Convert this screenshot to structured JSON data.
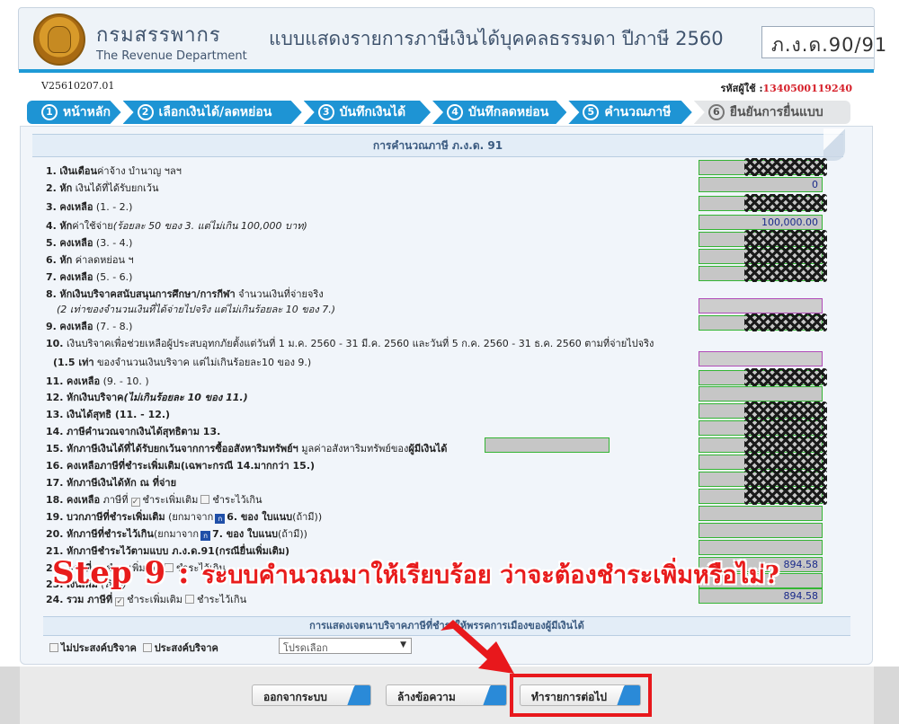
{
  "header": {
    "dept_thai": "กรมสรรพากร",
    "dept_en": "The Revenue Department",
    "title": "แบบแสดงรายการภาษีเงินได้บุคคลธรรมดา ปีภาษี 2560",
    "form_code": "ภ.ง.ด.90/91"
  },
  "version": "V25610207.01",
  "user": {
    "label": "รหัสผู้ใช้ :",
    "id": "1340500119240"
  },
  "steps": [
    {
      "num": "1",
      "label": "หน้าหลัก"
    },
    {
      "num": "2",
      "label": "เลือกเงินได้/ลดหย่อน"
    },
    {
      "num": "3",
      "label": "บันทึกเงินได้"
    },
    {
      "num": "4",
      "label": "บันทึกลดหย่อน"
    },
    {
      "num": "5",
      "label": "คำนวณภาษี"
    },
    {
      "num": "6",
      "label": "ยืนยันการยื่นแบบ"
    }
  ],
  "section_title": "การคำนวณภาษี ภ.ง.ด. 91",
  "rows": {
    "r1": {
      "no": "1.",
      "bold": "เงินเดือน",
      "rest": "ค่าจ้าง บำนาญ ฯลฯ"
    },
    "r2": {
      "no": "2.",
      "bold": "หัก",
      "rest": " เงินได้ที่ได้รับยกเว้น",
      "value": "0"
    },
    "r3": {
      "no": "3.",
      "bold": "คงเหลือ",
      "rest": " (1. - 2.)"
    },
    "r4": {
      "no": "4.",
      "bold": "หัก",
      "rest": "ค่าใช้จ่าย",
      "italic": "(ร้อยละ 50 ของ 3. แต่ไม่เกิน 100,000 บาท)",
      "value": "100,000.00"
    },
    "r5": {
      "no": "5.",
      "bold": "คงเหลือ",
      "rest": " (3. - 4.)"
    },
    "r6": {
      "no": "6.",
      "bold": "หัก",
      "rest": " ค่าลดหย่อน ฯ"
    },
    "r7": {
      "no": "7.",
      "bold": "คงเหลือ",
      "rest": " (5. - 6.)"
    },
    "r8": {
      "no": "8.",
      "bold": "หักเงินบริจาคสนับสนุนการศึกษา/การกีฬา",
      "rest": " จำนวนเงินที่จ่ายจริง",
      "sub": "(2 เท่าของจำนวนเงินที่ได้จ่ายไปจริง แต่ไม่เกินร้อยละ 10 ของ 7.)"
    },
    "r9": {
      "no": "9.",
      "bold": "คงเหลือ",
      "rest": " (7. - 8.)"
    },
    "r10": {
      "no": "10.",
      "text": "เงินบริจาคเพื่อช่วยเหลือผู้ประสบอุทกภัยตั้งแต่วันที่ 1 ม.ค. 2560 - 31 มี.ค. 2560 และวันที่ 5 ก.ค. 2560 - 31 ธ.ค. 2560 ตามที่จ่ายไปจริง",
      "sub_bold": "(1.5 เท่า",
      "sub_rest": " ของจำนวนเงินบริจาค แต่ไม่เกินร้อยละ10 ของ 9.)"
    },
    "r11": {
      "no": "11.",
      "bold": "คงเหลือ",
      "rest": " (9. - 10. )"
    },
    "r12": {
      "no": "12.",
      "bold": "หักเงินบริจาค",
      "italic": "(ไม่เกินร้อยละ 10 ของ 11.)"
    },
    "r13": {
      "no": "13.",
      "bold": "เงินได้สุทธิ (11. - 12.)"
    },
    "r14": {
      "no": "14.",
      "bold": "ภาษีคำนวณจากเงินได้สุทธิตาม 13."
    },
    "r15": {
      "no": "15.",
      "bold": "หักภาษีเงินได้ที่ได้รับยกเว้นจากการซื้ออสังหาริมทรัพย์ฯ",
      "rest": " มูลค่าอสังหาริมทรัพย์ของ",
      "bold2": "ผู้มีเงินได้"
    },
    "r16": {
      "no": "16.",
      "bold": "คงเหลือภาษีที่ชำระเพิ่มเติม(เฉพาะกรณี 14.มากกว่า 15.)"
    },
    "r17": {
      "no": "17.",
      "bold": "หักภาษีเงินได้หัก ณ ที่จ่าย"
    },
    "r18": {
      "no": "18.",
      "bold": "คงเหลือ",
      "rest": " ภาษีที่",
      "opt1": "ชำระเพิ่มเติม",
      "opt2": "ชำระไว้เกิน"
    },
    "r19": {
      "no": "19.",
      "bold": "บวกภาษีที่ชำระเพิ่มเติม",
      "rest": " (ยกมาจาก",
      "ref": "6. ของ ใบแนบ",
      "tail": "(ถ้ามี))"
    },
    "r20": {
      "no": "20.",
      "bold": "หักภาษีที่ชำระไว้เกิน",
      "rest": "(ยกมาจาก",
      "ref": "7. ของ ใบแนบ",
      "tail": "(ถ้ามี))"
    },
    "r21": {
      "no": "21.",
      "bold": "หักภาษีชำระไว้ตามแบบ ภ.ง.ด.91(กรณียื่นเพิ่มเติม)"
    },
    "r22": {
      "no": "22.",
      "bold": "ภาษีที่",
      "opt1": "ชำระเพิ่มเติม",
      "opt2": "ชำระไว้เกิน",
      "value": "894.58"
    },
    "r23": {
      "no": "23.",
      "bold": "เงินเพิ่ม",
      "rest": " (ถ้ามี)"
    },
    "r24": {
      "no": "24.",
      "bold": "รวม ภาษีที่",
      "opt1": "ชำระเพิ่มเติม",
      "opt2": "ชำระไว้เกิน",
      "value": "894.58"
    }
  },
  "annotation": {
    "step": "Step 9  :",
    "message": "ระบบคำนวณมาให้เรียบร้อย ว่าจะต้องชำระเพิ่มหรือไม่?"
  },
  "donation": {
    "title": "การแสดงเจตนาบริจาคภาษีที่ชำระให้พรรคการเมืองของผู้มีเงินได้",
    "opt_no": "ไม่ประสงค์บริจาค",
    "opt_yes": "ประสงค์บริจาค",
    "select_value": "โปรดเลือก"
  },
  "buttons": {
    "exit": "ออกจากระบบ",
    "clear": "ล้างข้อความ",
    "next": "ทำรายการต่อไป"
  },
  "colors": {
    "accent": "#1e94d4",
    "highlight": "#e8181c",
    "annotation": "#e81c1c",
    "field_border": "#34b534"
  }
}
